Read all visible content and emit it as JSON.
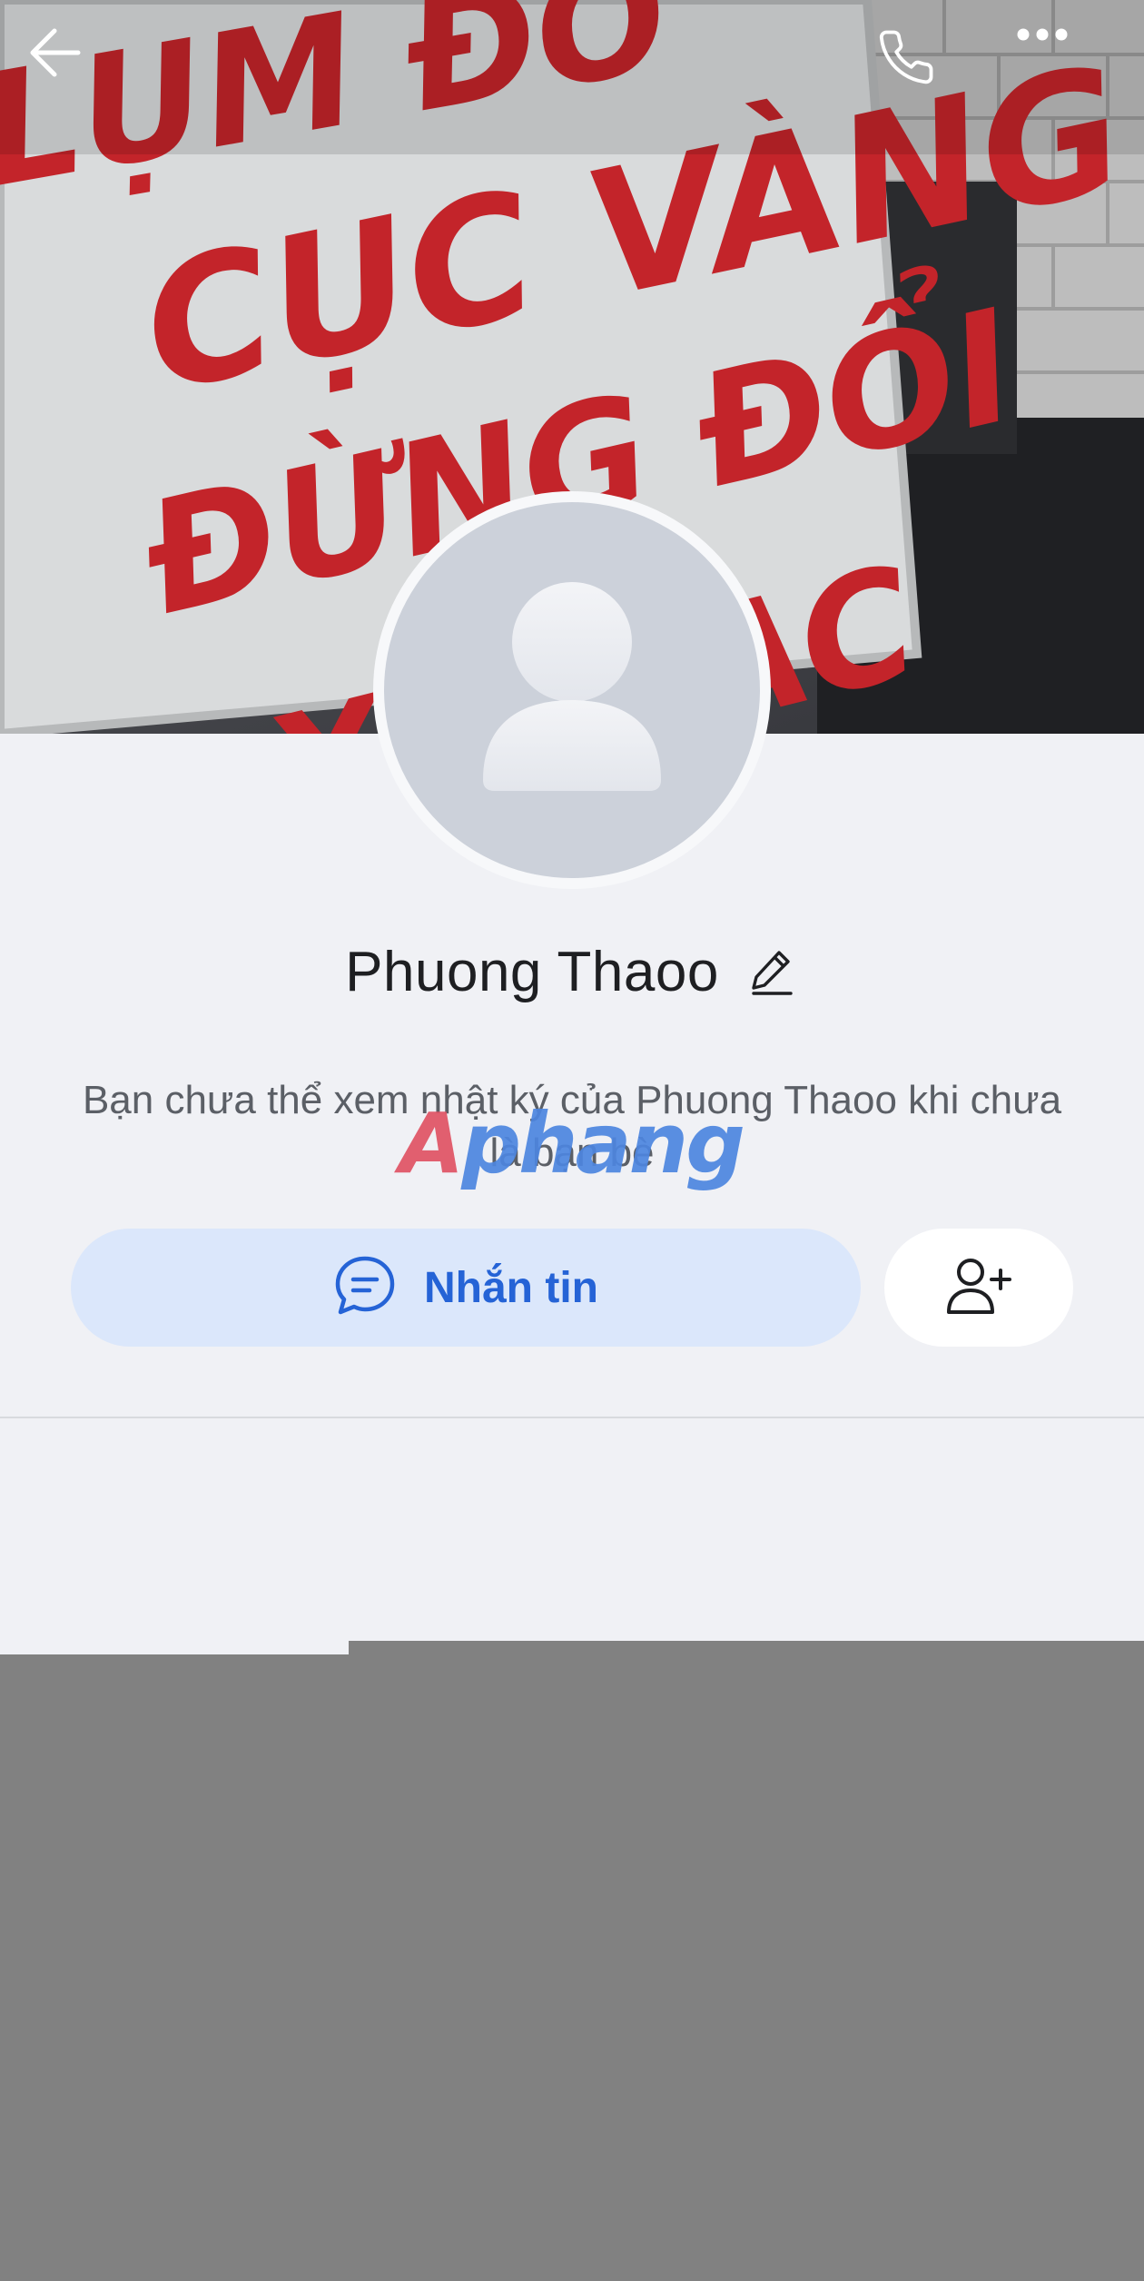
{
  "cover": {
    "sign_lines": [
      "LỤM ĐỒ",
      "CỤC VÀNG",
      "ĐỪNG ĐỔI",
      "XE MAC"
    ]
  },
  "header": {
    "back_icon": "arrow-left-icon",
    "call_icon": "phone-icon",
    "more_icon": "more-horizontal-icon"
  },
  "profile": {
    "name": "Phuong Thaoo",
    "diary_note": "Bạn chưa thể xem nhật ký của Phuong Thaoo khi chưa là bạn bè",
    "avatar_icon": "default-user-avatar-icon"
  },
  "actions": {
    "message_label": "Nhắn tin",
    "message_icon": "chat-bubble-icon",
    "add_friend_icon": "add-user-icon"
  },
  "watermark": {
    "part_a": "A",
    "part_b": "phang"
  },
  "colors": {
    "accent": "#2563d6",
    "message_bg": "#dbe7fb",
    "page_bg": "#f0f1f5",
    "overlay": "#818181"
  }
}
